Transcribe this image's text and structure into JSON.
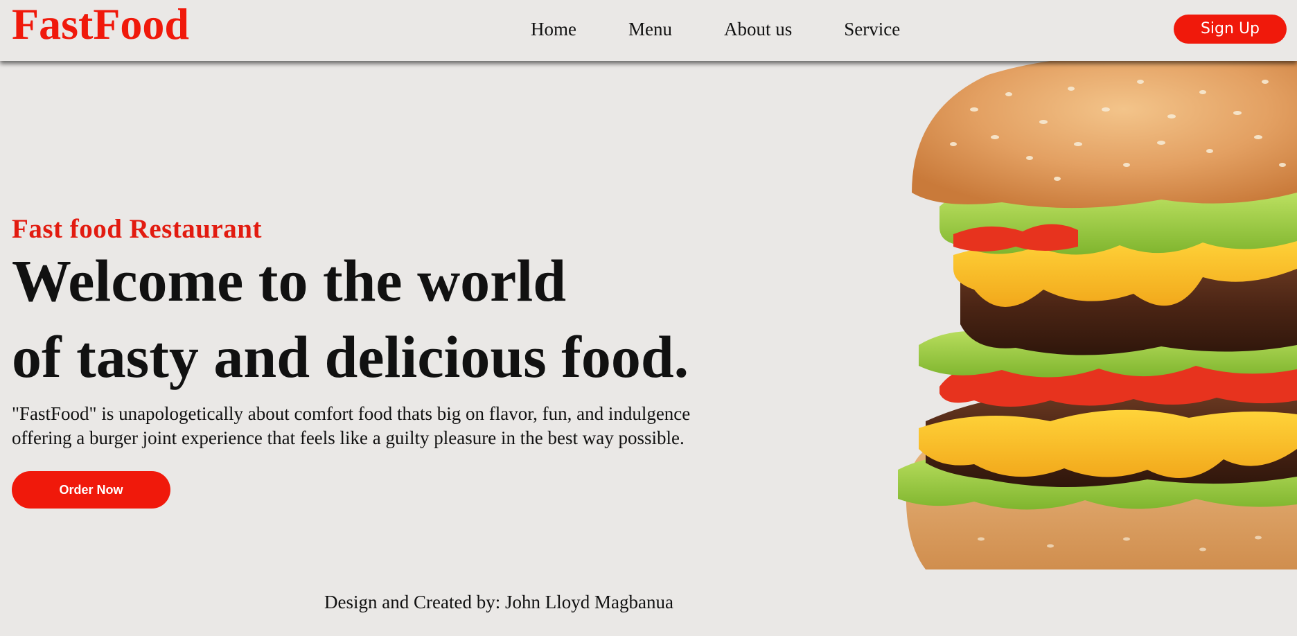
{
  "brand": {
    "name": "FastFood",
    "color": "#f0190b"
  },
  "nav": {
    "items": [
      {
        "label": "Home"
      },
      {
        "label": "Menu"
      },
      {
        "label": "About us"
      },
      {
        "label": "Service"
      }
    ],
    "signup_label": "Sign Up"
  },
  "hero": {
    "subtitle": "Fast food Restaurant",
    "headline_line1": "Welcome to the world",
    "headline_line2": "of tasty and delicious food.",
    "description_line1": "\"FastFood\" is unapologetically about comfort food thats big on flavor, fun, and indulgence",
    "description_line2": "offering a burger joint experience that feels like a guilty pleasure in the best way possible.",
    "order_label": "Order Now",
    "image": "burger-image"
  },
  "footer": {
    "credit": "Design and Created by: John Lloyd Magbanua"
  },
  "colors": {
    "background": "#eae8e6",
    "accent": "#f0190b",
    "text": "#111111"
  }
}
